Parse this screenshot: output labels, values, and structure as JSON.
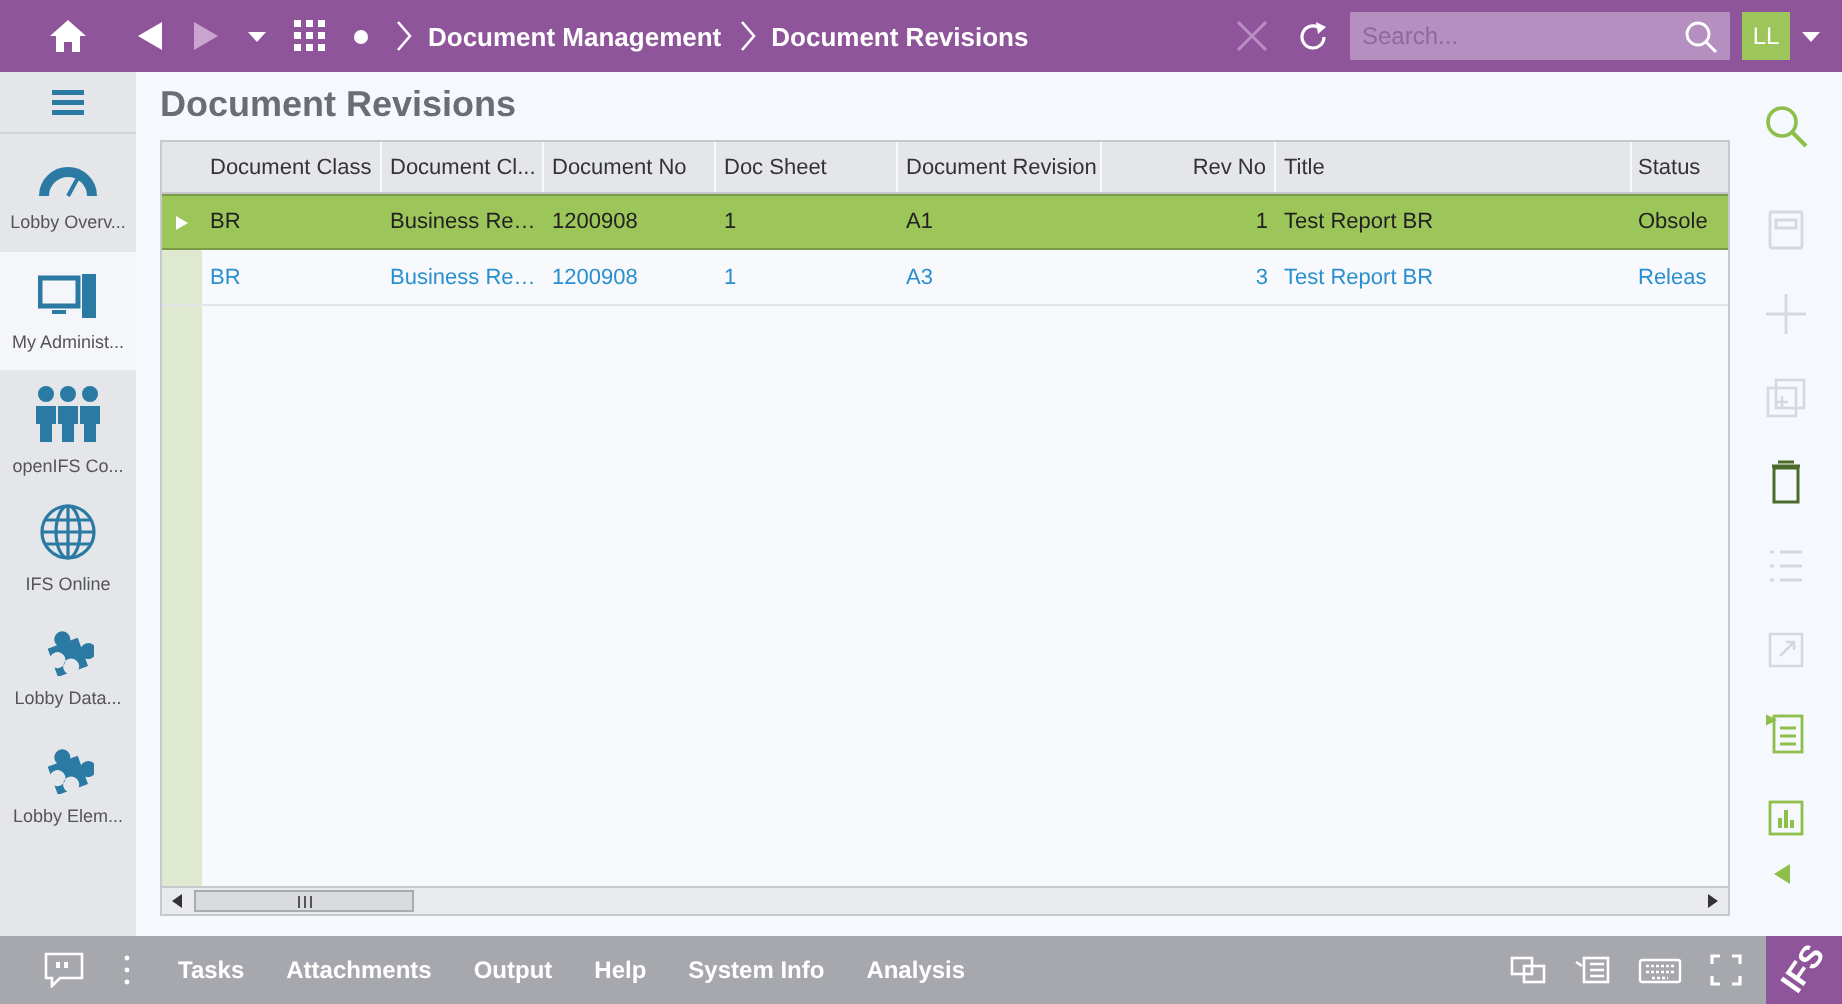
{
  "top_bar": {
    "breadcrumbs": [
      "Document Management",
      "Document Revisions"
    ],
    "search": {
      "placeholder": "Search..."
    },
    "user_initials": "LL"
  },
  "sidebar": {
    "items": [
      {
        "label": "Lobby Overv...",
        "selected": false
      },
      {
        "label": "My Administ...",
        "selected": true
      },
      {
        "label": "openIFS Co...",
        "selected": false
      },
      {
        "label": "IFS Online",
        "selected": false
      },
      {
        "label": "Lobby Data...",
        "selected": false
      },
      {
        "label": "Lobby Elem...",
        "selected": false
      }
    ]
  },
  "page_title": "Document Revisions",
  "table": {
    "columns": [
      "Document Class",
      "Document Cl...",
      "Document No",
      "Doc Sheet",
      "Document Revision",
      "Rev No",
      "Title",
      "Status"
    ],
    "rows": [
      {
        "selected": true,
        "cells": [
          "BR",
          "Business Re…",
          "1200908",
          "1",
          "A1",
          "1",
          "Test Report BR",
          "Obsole"
        ]
      },
      {
        "selected": false,
        "cells": [
          "BR",
          "Business Re…",
          "1200908",
          "1",
          "A3",
          "3",
          "Test Report BR",
          "Releas"
        ]
      }
    ]
  },
  "toolbar": [
    {
      "disabled": false
    },
    {
      "disabled": true
    },
    {
      "disabled": true
    },
    {
      "disabled": true
    },
    {
      "disabled": false
    },
    {
      "disabled": true
    },
    {
      "disabled": true
    },
    {
      "disabled": false
    },
    {
      "disabled": false
    }
  ],
  "bottom_bar": {
    "tabs": [
      "Tasks",
      "Attachments",
      "Output",
      "Help",
      "System Info",
      "Analysis"
    ],
    "logo": "IFS"
  }
}
